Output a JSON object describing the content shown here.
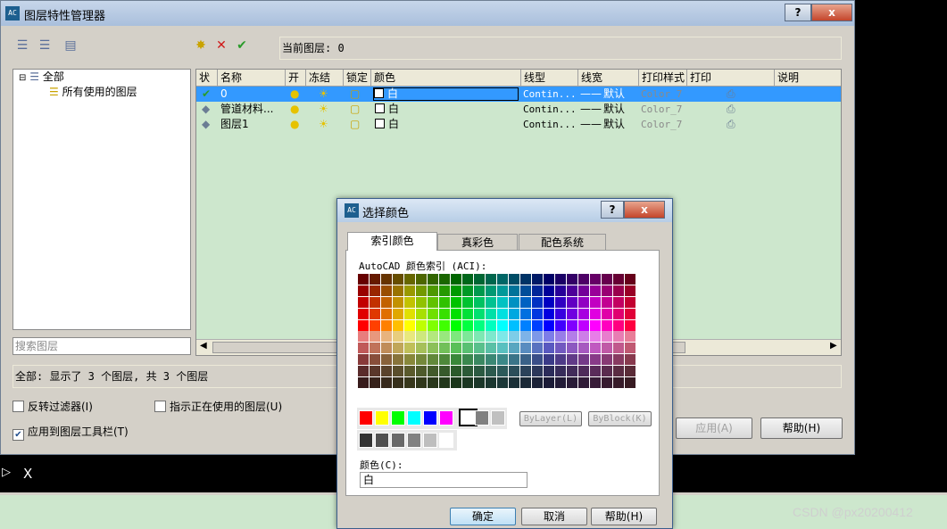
{
  "main_window": {
    "title": "图层特性管理器",
    "help_btn": "?",
    "close_btn": "x",
    "current_layer_label": "当前图层: 0",
    "tree": {
      "all": "全部",
      "all_used": "所有使用的图层"
    },
    "search_placeholder": "搜索图层",
    "columns": [
      "状",
      "名称",
      "开",
      "冻结",
      "锁定",
      "颜色",
      "线型",
      "线宽",
      "打印样式",
      "打印",
      "说明"
    ],
    "rows": [
      {
        "name": "0",
        "color": "白",
        "linetype": "Contin...",
        "lineweight": "默认",
        "plotstyle": "Color_7",
        "selected": true
      },
      {
        "name": "管道材料...",
        "color": "白",
        "linetype": "Contin...",
        "lineweight": "默认",
        "plotstyle": "Color_7",
        "selected": false
      },
      {
        "name": "图层1",
        "color": "白",
        "linetype": "Contin...",
        "lineweight": "默认",
        "plotstyle": "Color_7",
        "selected": false
      }
    ],
    "status_text": "全部: 显示了 3 个图层, 共 3 个图层",
    "invert_filter": "反转过滤器(I)",
    "indicate_in_use": "指示正在使用的图层(U)",
    "apply_to_toolbar": "应用到图层工具栏(T)",
    "apply_btn": "应用(A)",
    "help_button": "帮助(H)"
  },
  "command_prompt": "X",
  "color_dialog": {
    "title": "选择颜色",
    "help_btn": "?",
    "close_btn": "x",
    "tabs": [
      "索引颜色",
      "真彩色",
      "配色系统"
    ],
    "aci_label": "AutoCAD 颜色索引 (ACI):",
    "bylayer": "ByLayer(L)",
    "byblock": "ByBlock(K)",
    "color_label": "颜色(C):",
    "color_value": "白",
    "ok": "确定",
    "cancel": "取消",
    "help": "帮助(H)",
    "standard_colors": [
      "#ff0000",
      "#ffff00",
      "#00ff00",
      "#00ffff",
      "#0000ff",
      "#ff00ff",
      "#ffffff",
      "#808080",
      "#c0c0c0"
    ],
    "gray_colors": [
      "#333333",
      "#505050",
      "#696969",
      "#828282",
      "#bebebe",
      "#ffffff"
    ]
  },
  "watermark": "CSDN @px20200412"
}
